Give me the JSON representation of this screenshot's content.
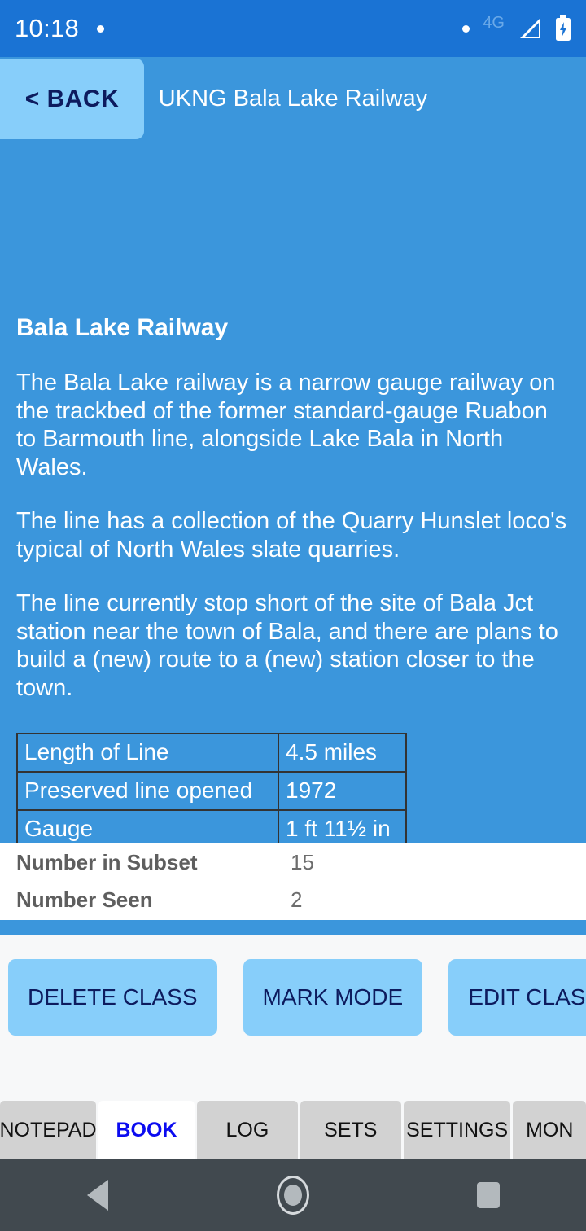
{
  "status_bar": {
    "time": "10:18",
    "notification_dot_icon": "dot-icon",
    "privacy_dot_icon": "dot-icon",
    "network_type": "4G",
    "signal_icon": "signal-icon",
    "battery_icon": "battery-charging-icon"
  },
  "header": {
    "back_label": "< BACK",
    "title": "UKNG Bala Lake Railway"
  },
  "article": {
    "title": "Bala Lake Railway",
    "paragraphs": [
      "The Bala Lake railway is a narrow gauge railway on the trackbed of the former standard-gauge Ruabon to Barmouth line, alongside Lake Bala in North Wales.",
      "The line has a collection of the Quarry Hunslet loco's typical of North Wales slate quarries.",
      "The line currently stop short of the site of Bala Jct station near the town of Bala, and there are plans to build a (new) route to a (new) station closer to the town."
    ],
    "facts": [
      {
        "label": "Length of Line",
        "value": "4.5 miles"
      },
      {
        "label": "Preserved line opened",
        "value": "1972"
      },
      {
        "label": "Gauge",
        "value": "1 ft 11½ in"
      }
    ]
  },
  "stats": [
    {
      "label": "Number in Subset",
      "value": "15"
    },
    {
      "label": "Number Seen",
      "value": "2"
    }
  ],
  "actions": [
    {
      "label": "DELETE CLASS"
    },
    {
      "label": "MARK MODE"
    },
    {
      "label": "EDIT CLASS"
    }
  ],
  "tabs": [
    {
      "label": "NOTEPAD",
      "active": false
    },
    {
      "label": "BOOK",
      "active": true
    },
    {
      "label": "LOG",
      "active": false
    },
    {
      "label": "SETS",
      "active": false
    },
    {
      "label": "SETTINGS",
      "active": false
    },
    {
      "label": "MON",
      "active": false
    }
  ],
  "nav_bar": {
    "back_icon": "triangle-back-icon",
    "home_icon": "circle-home-icon",
    "recents_icon": "square-recents-icon"
  },
  "colors": {
    "status_bar": "#1a73d4",
    "app_blue": "#3b96dc",
    "button_blue": "#87cefa",
    "button_text": "#0d1b5e",
    "active_tab_text": "#0b0bf0",
    "nav_bar": "#41494f"
  }
}
